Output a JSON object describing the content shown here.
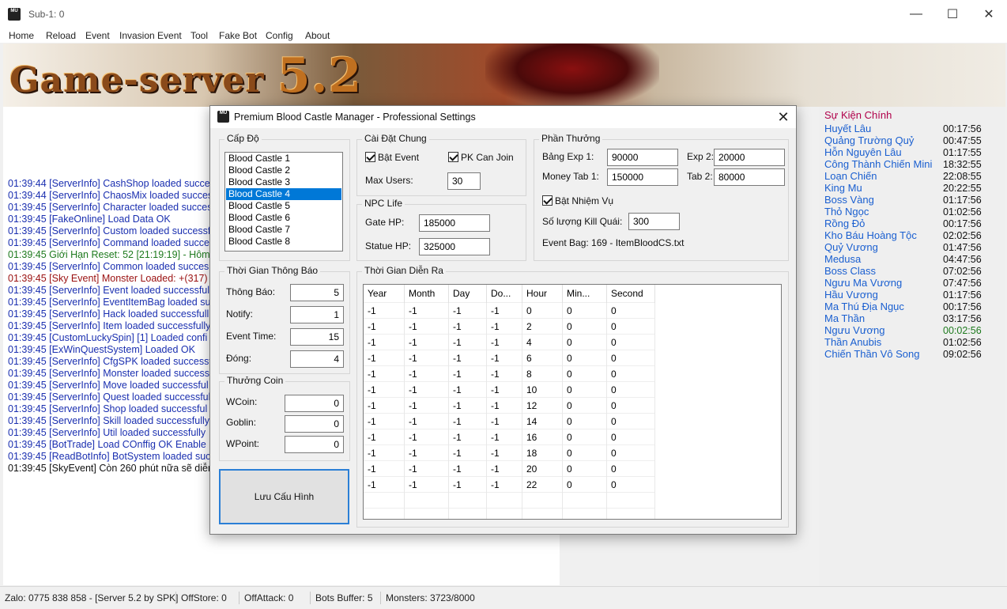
{
  "window": {
    "title": "Sub-1: 0",
    "app_icon": "MU"
  },
  "menu": [
    "Home",
    "Reload",
    "Event",
    "Invasion Event",
    "Tool",
    "Fake Bot",
    "Config",
    "About"
  ],
  "banner": {
    "logo_text": "Game-server",
    "logo_version": "5.2"
  },
  "log": [
    {
      "text": "01:39:44 [ServerInfo] CashShop loaded succes",
      "color": "#1a2fb0"
    },
    {
      "text": "01:39:44 [ServerInfo] ChaosMix loaded succes",
      "color": "#1a2fb0"
    },
    {
      "text": "01:39:45 [ServerInfo] Character loaded succes",
      "color": "#1a2fb0"
    },
    {
      "text": "01:39:45 [FakeOnline] Load Data OK",
      "color": "#1a2fb0"
    },
    {
      "text": "01:39:45 [ServerInfo] Custom loaded successf",
      "color": "#1a2fb0"
    },
    {
      "text": "01:39:45 [ServerInfo] Command loaded succes",
      "color": "#1a2fb0"
    },
    {
      "text": "01:39:45 Giới Hạn Reset: 52 [21:19:19] - Hôm",
      "color": "#1e7a1e"
    },
    {
      "text": "01:39:45 [ServerInfo] Common loaded succes",
      "color": "#1a2fb0"
    },
    {
      "text": "01:39:45 [Sky Event] Monster Loaded: +(317)",
      "color": "#9a1010"
    },
    {
      "text": "01:39:45 [ServerInfo] Event loaded successfully",
      "color": "#1a2fb0"
    },
    {
      "text": "01:39:45 [ServerInfo] EventItemBag loaded suc",
      "color": "#1a2fb0"
    },
    {
      "text": "01:39:45 [ServerInfo] Hack loaded successfull",
      "color": "#1a2fb0"
    },
    {
      "text": "01:39:45 [ServerInfo] Item loaded successfully",
      "color": "#1a2fb0"
    },
    {
      "text": "01:39:45 [CustomLuckySpin] [1] Loaded confi",
      "color": "#1a2fb0"
    },
    {
      "text": "01:39:45 [ExWinQuestSystem] Loaded OK",
      "color": "#1a2fb0"
    },
    {
      "text": "01:39:45 [ServerInfo] CfgSPK loaded successf",
      "color": "#1a2fb0"
    },
    {
      "text": "01:39:45 [ServerInfo] Monster loaded success",
      "color": "#1a2fb0"
    },
    {
      "text": "01:39:45 [ServerInfo] Move loaded successful",
      "color": "#1a2fb0"
    },
    {
      "text": "01:39:45 [ServerInfo] Quest loaded successful",
      "color": "#1a2fb0"
    },
    {
      "text": "01:39:45 [ServerInfo] Shop loaded successful",
      "color": "#1a2fb0"
    },
    {
      "text": "01:39:45 [ServerInfo] Skill loaded successfully",
      "color": "#1a2fb0"
    },
    {
      "text": "01:39:45 [ServerInfo] Util loaded successfully",
      "color": "#1a2fb0"
    },
    {
      "text": "01:39:45 [BotTrade] Load COnffig OK Enable 1",
      "color": "#1a2fb0"
    },
    {
      "text": "01:39:45 [ReadBotInfo] BotSystem loaded successfully",
      "color": "#1a2fb0"
    },
    {
      "text": "01:39:45 [SkyEvent] Còn 260 phút nữa sẽ diễn ra.",
      "color": "#111111"
    }
  ],
  "events": {
    "title": "Sự Kiện Chính",
    "items": [
      {
        "name": "Huyết Lâu",
        "time": "00:17:56"
      },
      {
        "name": "Quảng Trường Quỷ",
        "time": "00:47:55"
      },
      {
        "name": "Hỗn Nguyên Lâu",
        "time": "01:17:55"
      },
      {
        "name": "Công Thành Chiến Mini",
        "time": "18:32:55"
      },
      {
        "name": "Loạn Chiến",
        "time": "22:08:55"
      },
      {
        "name": "King Mu",
        "time": "20:22:55"
      },
      {
        "name": "Boss Vàng",
        "time": "01:17:56"
      },
      {
        "name": "Thỏ Ngọc",
        "time": "01:02:56"
      },
      {
        "name": "Rồng Đỏ",
        "time": "00:17:56"
      },
      {
        "name": "Kho Báu Hoàng Tộc",
        "time": "02:02:56"
      },
      {
        "name": "Quỷ Vương",
        "time": "01:47:56"
      },
      {
        "name": "Medusa",
        "time": "04:47:56"
      },
      {
        "name": "Boss Class",
        "time": "07:02:56"
      },
      {
        "name": "Ngưu Ma Vương",
        "time": "07:47:56"
      },
      {
        "name": "Hầu Vương",
        "time": "01:17:56"
      },
      {
        "name": "Ma Thú Địa Ngục",
        "time": "00:17:56"
      },
      {
        "name": "Ma Thần",
        "time": "03:17:56"
      },
      {
        "name": "Ngưu Vương",
        "time": "00:02:56",
        "time_color": "#1e7a1e"
      },
      {
        "name": "Thần Anubis",
        "time": "01:02:56"
      },
      {
        "name": "Chiến Thần Vô Song",
        "time": "09:02:56"
      }
    ]
  },
  "statusbar": [
    "Zalo: 0775 838 858 - [Server 5.2 by SPK]",
    "OffStore: 0",
    "OffAttack: 0",
    "Bots Buffer: 5",
    "Monsters: 3723/8000"
  ],
  "dialog": {
    "title": "Premium Blood Castle Manager - Professional Settings",
    "level": {
      "label": "Cấp Độ",
      "items": [
        "Blood Castle 1",
        "Blood Castle 2",
        "Blood Castle 3",
        "Blood Castle 4",
        "Blood Castle 5",
        "Blood Castle 6",
        "Blood Castle 7",
        "Blood Castle 8"
      ],
      "selected": "Blood Castle 4"
    },
    "general": {
      "label": "Cài Đặt Chung",
      "enable_event": "Bật Event",
      "pk_can_join": "PK Can Join",
      "max_users_label": "Max Users:",
      "max_users": "30"
    },
    "npc": {
      "label": "NPC Life",
      "gate_label": "Gate HP:",
      "gate_hp": "185000",
      "statue_label": "Statue HP:",
      "statue_hp": "325000"
    },
    "reward": {
      "label": "Phần Thưởng",
      "exp1_label": "Bảng Exp 1:",
      "exp1": "90000",
      "exp2_label": "Exp 2:",
      "exp2": "20000",
      "money1_label": "Money Tab 1:",
      "money1": "150000",
      "tab2_label": "Tab 2:",
      "tab2": "80000",
      "enable_quest": "Bật Nhiệm Vụ",
      "kill_label": "Số lượng Kill Quái:",
      "kill": "300",
      "bag": "Event Bag: 169 - ItemBloodCS.txt"
    },
    "notice": {
      "label": "Thời Gian Thông Báo",
      "notice_label": "Thông Báo:",
      "notice": "5",
      "notify_label": "Notify:",
      "notify": "1",
      "event_time_label": "Event Time:",
      "event_time": "15",
      "close_label": "Đóng:",
      "close": "4"
    },
    "coin": {
      "label": "Thưởng Coin",
      "wcoin_label": "WCoin:",
      "wcoin": "0",
      "goblin_label": "Goblin:",
      "goblin": "0",
      "wpoint_label": "WPoint:",
      "wpoint": "0"
    },
    "save_label": "Lưu Cấu Hình",
    "schedule": {
      "label": "Thời Gian Diễn Ra",
      "columns": [
        "Year",
        "Month",
        "Day",
        "Do...",
        "Hour",
        "Min...",
        "Second"
      ],
      "rows": [
        [
          "-1",
          "-1",
          "-1",
          "-1",
          "0",
          "0",
          "0"
        ],
        [
          "-1",
          "-1",
          "-1",
          "-1",
          "2",
          "0",
          "0"
        ],
        [
          "-1",
          "-1",
          "-1",
          "-1",
          "4",
          "0",
          "0"
        ],
        [
          "-1",
          "-1",
          "-1",
          "-1",
          "6",
          "0",
          "0"
        ],
        [
          "-1",
          "-1",
          "-1",
          "-1",
          "8",
          "0",
          "0"
        ],
        [
          "-1",
          "-1",
          "-1",
          "-1",
          "10",
          "0",
          "0"
        ],
        [
          "-1",
          "-1",
          "-1",
          "-1",
          "12",
          "0",
          "0"
        ],
        [
          "-1",
          "-1",
          "-1",
          "-1",
          "14",
          "0",
          "0"
        ],
        [
          "-1",
          "-1",
          "-1",
          "-1",
          "16",
          "0",
          "0"
        ],
        [
          "-1",
          "-1",
          "-1",
          "-1",
          "18",
          "0",
          "0"
        ],
        [
          "-1",
          "-1",
          "-1",
          "-1",
          "20",
          "0",
          "0"
        ],
        [
          "-1",
          "-1",
          "-1",
          "-1",
          "22",
          "0",
          "0"
        ]
      ]
    }
  }
}
